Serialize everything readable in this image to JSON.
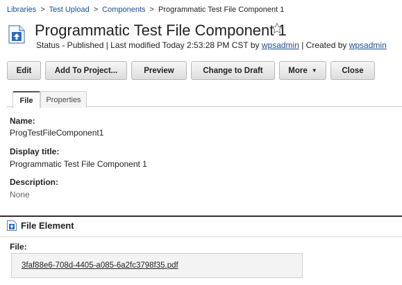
{
  "breadcrumb": {
    "items": [
      "Libraries",
      "Test Upload",
      "Components"
    ],
    "current": "Programmatic Test File Component 1",
    "separator": ">"
  },
  "header": {
    "title": "Programmatic Test File Component 1",
    "status_prefix": "Status - Published | Last modified Today 2:53:28 PM CST by ",
    "modified_by": "wpsadmin",
    "created_sep": " | Created by ",
    "created_by": "wpsadmin"
  },
  "toolbar": {
    "edit": "Edit",
    "add_to_project": "Add To Project...",
    "preview": "Preview",
    "change_to_draft": "Change to Draft",
    "more": "More",
    "more_caret": "▼",
    "close": "Close"
  },
  "tabs": {
    "file": "File",
    "properties": "Properties"
  },
  "fields": {
    "name_label": "Name:",
    "name_value": "ProgTestFileComponent1",
    "display_title_label": "Display title:",
    "display_title_value": "Programmatic Test File Component 1",
    "description_label": "Description:",
    "description_value": "None"
  },
  "file_element": {
    "heading": "File Element",
    "file_label": "File:",
    "file_name": "3faf88e6-708d-4405-a085-6a2fc3798f35.pdf"
  },
  "colors": {
    "link": "#1a4f8e",
    "accent_icon": "#2a6ebb"
  },
  "icons": [
    "file-component-icon",
    "star-icon",
    "file-element-icon"
  ]
}
